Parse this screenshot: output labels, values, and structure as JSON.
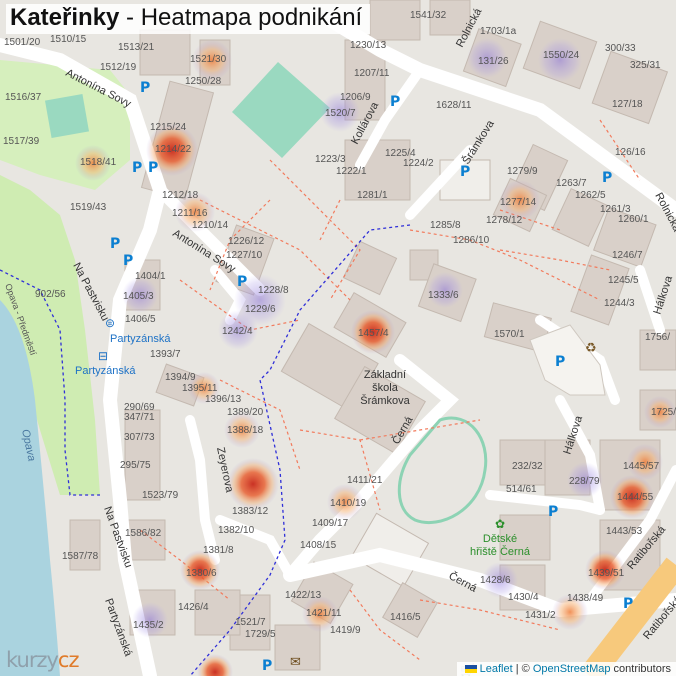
{
  "title": {
    "locality": "Kateřinky",
    "separator": " - ",
    "subtitle": "Heatmapa podnikání"
  },
  "logo": {
    "text_main": "kurzy",
    "text_suffix": "cz"
  },
  "attribution": {
    "leaflet": "Leaflet",
    "sep": " | © ",
    "osm": "OpenStreetMap",
    "contributors": " contributors"
  },
  "colors": {
    "heat_red": "#d93a1e",
    "heat_orange": "#f08a3c",
    "heat_purple": "#8a6fd0",
    "road": "#ffffff",
    "building": "#d9d0c9",
    "park": "#cfecb2",
    "water": "#aad3df",
    "pitch": "#aae0cb",
    "parking": "#0b7fd1",
    "tram": "#1e72c6",
    "path_red": "#f27a5c",
    "boundary": "#2f2fd8"
  },
  "streets": [
    "Antonína Sovy",
    "Antonína Sovy",
    "Kollárova",
    "Šrámkova",
    "Rolnická",
    "Rolnická",
    "Hálkova",
    "Hálkova",
    "Na Pastvisku",
    "Na Pastvisku",
    "Zeyerova",
    "Černá",
    "Černá",
    "Ratibořská",
    "Ratibořská",
    "Partyzánská",
    "Opava",
    "Opava - Předměstí"
  ],
  "addresses": [
    "1501/20",
    "1510/15",
    "1513/21",
    "1512/19",
    "1521/30",
    "1250/28",
    "1516/37",
    "1206/9",
    "1520/7",
    "1517/39",
    "1215/24",
    "1214/22",
    "1518/41",
    "1212/18",
    "1211/16",
    "1210/14",
    "1519/43",
    "1226/12",
    "1227/10",
    "1228/8",
    "1229/6",
    "1242/4",
    "1404/1",
    "1405/3",
    "1406/5",
    "902/56",
    "1393/7",
    "1394/9",
    "1395/11",
    "1396/13",
    "1389/20",
    "1388/18",
    "290/69",
    "347/71",
    "307/73",
    "295/75",
    "1523/79",
    "1586/82",
    "1587/78",
    "1382/10",
    "1383/12",
    "1381/8",
    "1380/6",
    "1426/4",
    "1435/2",
    "1422/13",
    "1421/11",
    "1419/9",
    "1416/5",
    "1521/7",
    "1729/5",
    "1408/15",
    "1409/17",
    "1410/19",
    "1411/21",
    "1541/32",
    "1703/1a",
    "1230/13",
    "1207/11",
    "1628/11",
    "1225/4",
    "1224/2",
    "1223/3",
    "1222/1",
    "1281/1",
    "1550/24",
    "300/33",
    "325/31",
    "131/26",
    "127/18",
    "126/16",
    "1279/9",
    "1263/7",
    "1262/5",
    "1261/3",
    "1260/1",
    "1277/14",
    "1278/12",
    "1285/8",
    "1286/10",
    "1246/7",
    "1245/5",
    "1244/3",
    "1333/6",
    "1457/4",
    "1570/1",
    "1756/",
    "1725/",
    "232/32",
    "514/61",
    "228/79",
    "1445/57",
    "1444/55",
    "1443/53",
    "1439/51",
    "1428/6",
    "1430/4",
    "1431/2",
    "1438/49"
  ],
  "pois": {
    "school_name": "Základní škola Šrámkova",
    "playground_name": "Dětské hřiště Černá",
    "tram_stop_1": "Partyzánská",
    "tram_stop_2": "Partyzánská",
    "parking_label": "P"
  },
  "heat_spots": [
    {
      "intensity": 0.95
    },
    {
      "intensity": 0.9
    },
    {
      "intensity": 0.85
    },
    {
      "intensity": 0.8
    },
    {
      "intensity": 0.78
    },
    {
      "intensity": 0.75
    },
    {
      "intensity": 0.72
    },
    {
      "intensity": 0.7
    },
    {
      "intensity": 0.65
    },
    {
      "intensity": 0.6
    },
    {
      "intensity": 0.58
    },
    {
      "intensity": 0.55
    },
    {
      "intensity": 0.5
    },
    {
      "intensity": 0.5
    },
    {
      "intensity": 0.45
    },
    {
      "intensity": 0.45
    },
    {
      "intensity": 0.4
    },
    {
      "intensity": 0.4
    },
    {
      "intensity": 0.35
    },
    {
      "intensity": 0.35
    },
    {
      "intensity": 0.3
    },
    {
      "intensity": 0.3
    },
    {
      "intensity": 0.3
    },
    {
      "intensity": 0.3
    },
    {
      "intensity": 0.25
    },
    {
      "intensity": 0.25
    },
    {
      "intensity": 0.25
    },
    {
      "intensity": 0.2
    }
  ]
}
